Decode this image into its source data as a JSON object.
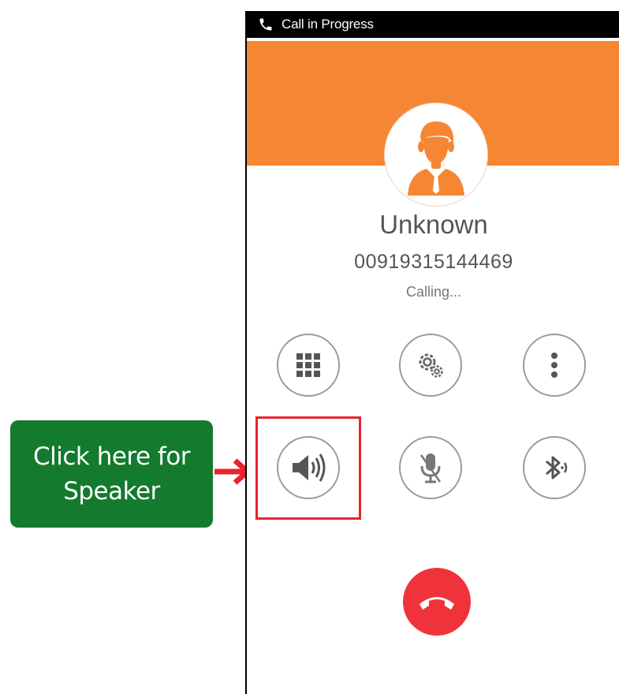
{
  "status_bar": {
    "title": "Call in Progress",
    "icon": "phone-icon"
  },
  "colors": {
    "accent": "#f58634",
    "end_call": "#f0333a",
    "callout_bg": "#137a2e",
    "highlight": "#e8242d"
  },
  "caller": {
    "name": "Unknown",
    "number": "00919315144469",
    "status": "Calling..."
  },
  "controls": [
    {
      "name": "dialpad",
      "icon": "dialpad-icon"
    },
    {
      "name": "settings",
      "icon": "gears-icon"
    },
    {
      "name": "more",
      "icon": "more-vert-icon"
    },
    {
      "name": "speaker",
      "icon": "speaker-icon"
    },
    {
      "name": "mute",
      "icon": "mic-off-icon"
    },
    {
      "name": "bluetooth",
      "icon": "bluetooth-icon"
    }
  ],
  "callout": {
    "line1": "Click here for",
    "line2": "Speaker"
  }
}
